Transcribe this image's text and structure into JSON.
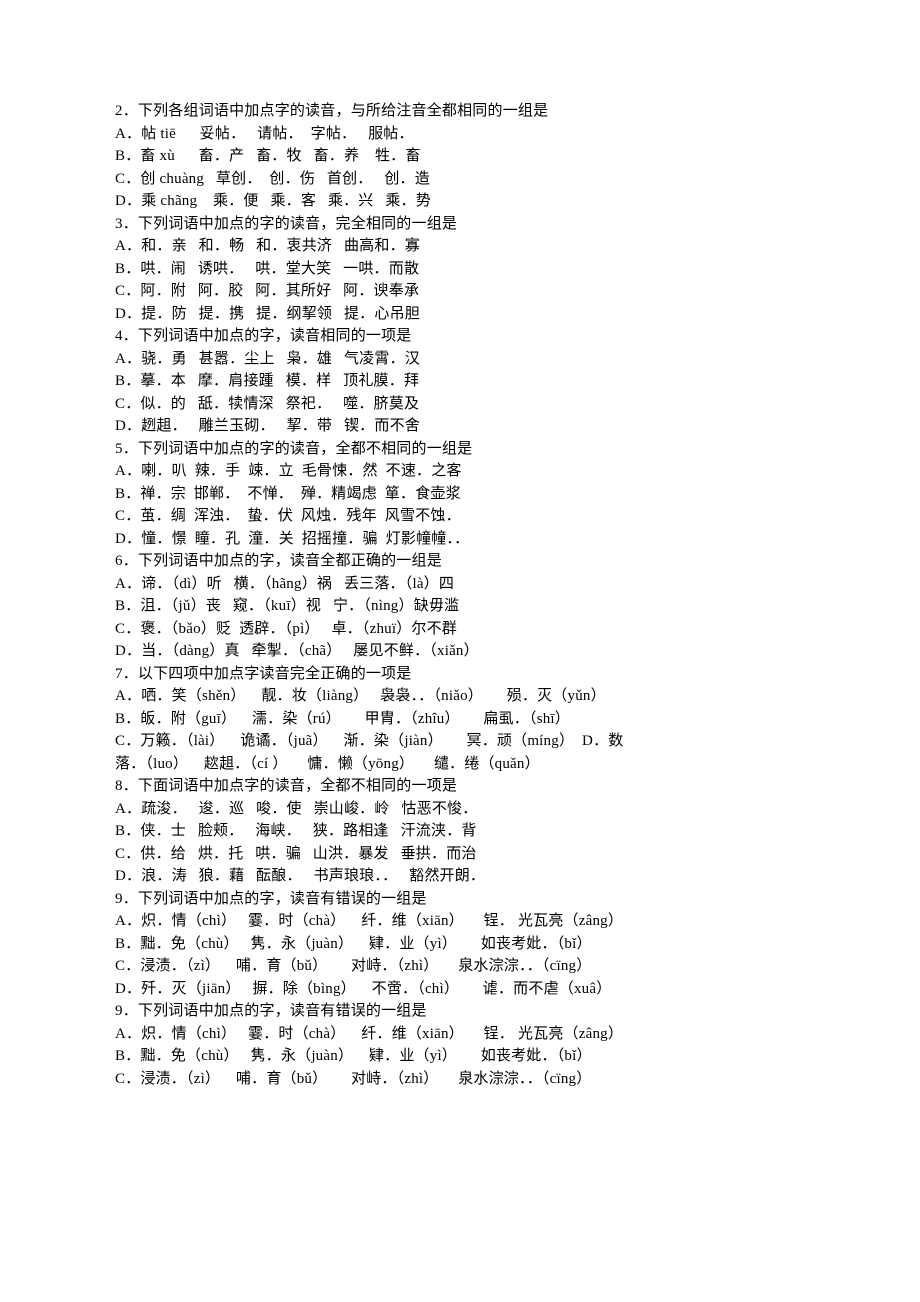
{
  "lines": [
    "2．下列各组词语中加点字的读音，与所给注音全都相同的一组是",
    "A．帖 tiē      妥帖．   请帖．  字帖．   服帖．",
    "B．畜 xù      畜．产   畜．牧   畜．养    牲．畜",
    "C．创 chuàng   草创．  创．伤   首创．   创．造",
    "D．乘 chãng    乘．便   乘．客   乘．兴   乘．势",
    "3．下列词语中加点的字的读音，完全相同的一组是",
    "A．和．亲   和．畅   和．衷共济   曲高和．寡",
    "B．哄．闹   诱哄．   哄．堂大笑   一哄．而散",
    "C．阿．附   阿．胶   阿．其所好   阿．谀奉承",
    "D．提．防   提．携   提．纲挈领   提．心吊胆",
    "4．下列词语中加点的字，读音相同的一项是",
    "A．骁．勇   甚嚣．尘上   枭．雄   气凌霄．汉",
    "B．摹．本   摩．肩接踵   模．样   顶礼膜．拜",
    "C．似．的   舐．犊情深   祭祀．   噬．脐莫及",
    "D．趔趄．   雕兰玉砌．   挈．带   锲．而不舍",
    "5．下列词语中加点的字的读音，全都不相同的一组是",
    "A．喇．叭  辣．手  竦．立  毛骨悚．然  不速．之客",
    "B．禅．宗  邯郸．  不惮．  殚．精竭虑  箪．食壶浆",
    "C．茧．绸  浑浊．  蛰．伏  风烛．残年  风雪不蚀．",
    "D．憧．憬  瞳．孔  潼．关  招摇撞．骗  灯影幢幢．．",
    "6．下列词语中加点的字，读音全都正确的一组是",
    "A．谛．（dì）听   横．（hãng）祸   丢三落．（là）四",
    "B．沮．（jǔ）丧   窥．（kuī）视   宁．（nìng）缺毋滥",
    "C．褒．（bǎo）贬  透辟．（pì）   卓．（zhuï）尔不群",
    "D．当．（dàng）真   牵掣．（chã）   屡见不鲜．（xiǎn）",
    "7．以下四项中加点字读音完全正确的一项是",
    "A．哂．笑（shěn）    靓．妆（liàng）   袅袅．．（niǎo）      殒．灭（yǔn）",
    "B．皈．附（guī）    濡．染（rú）      甲胄．（zhîu）      扁虱．（shī）",
    "C．万籁．（lài）    诡谲．（juã）    渐．染（jiàn）      冥．顽（míng）  D．数",
    "落．（luo）    趑趄．（cí ）     慵．懒（yōng）     缱．绻（quǎn）",
    "8．下面词语中加点字的读音，全都不相同的一项是",
    "A．疏浚．   逡．巡   唆．使   崇山峻．岭   怙恶不悛．",
    "B．侠．士   脸颊．   海峡．   狭．路相逢   汗流浃．背",
    "C．供．给   烘．托   哄．骗   山洪．暴发   垂拱．而治",
    "D．浪．涛   狼．藉   酝酿．   书声琅琅．．   豁然开朗．",
    "9．下列词语中加点的字，读音有错误的一组是",
    "A．炽．情（chì）   霎．时（chà）    纤．维（xiān）     锃． 光瓦亮（zâng）",
    "B．黜．免（chù）   隽．永（juàn）    肄．业（yì）      如丧考妣．（bǐ）",
    "C．浸渍．（zì）    哺．育（bǔ）      对峙．（zhì）     泉水淙淙．．（cïng）",
    "D．歼．灭（jiān）   摒．除（bìng）    不啻．（chì）      谑．而不虐（xuâ）",
    "9．下列词语中加点的字，读音有错误的一组是",
    "A．炽．情（chì）   霎．时（chà）    纤．维（xiān）     锃． 光瓦亮（zâng）",
    "B．黜．免（chù）   隽．永（juàn）    肄．业（yì）      如丧考妣．（bǐ）",
    "C．浸渍．（zì）    哺．育（bǔ）      对峙．（zhì）     泉水淙淙．．（cïng）"
  ]
}
